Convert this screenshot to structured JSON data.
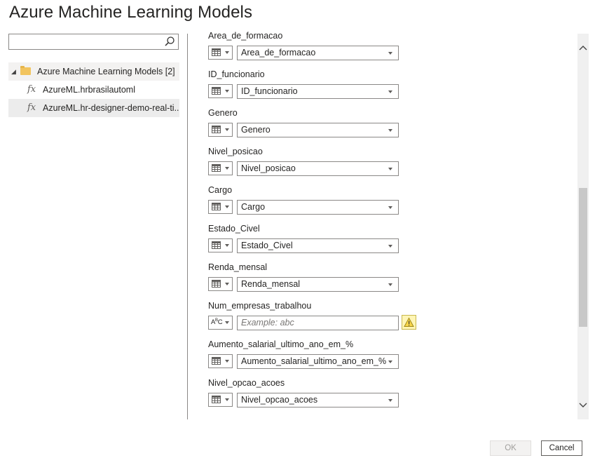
{
  "title": "Azure Machine Learning Models",
  "search": {
    "placeholder": "",
    "value": ""
  },
  "tree": {
    "folder": {
      "label": "Azure Machine Learning Models [2]"
    },
    "items": [
      {
        "label": "AzureML.hrbrasilautoml",
        "selected": false
      },
      {
        "label": "AzureML.hr-designer-demo-real-ti...",
        "selected": true
      }
    ]
  },
  "parameters": [
    {
      "label": "Area_de_formacao",
      "kind": "column",
      "value": "Area_de_formacao"
    },
    {
      "label": "ID_funcionario",
      "kind": "column",
      "value": "ID_funcionario"
    },
    {
      "label": "Genero",
      "kind": "column",
      "value": "Genero"
    },
    {
      "label": "Nivel_posicao",
      "kind": "column",
      "value": "Nivel_posicao"
    },
    {
      "label": "Cargo",
      "kind": "column",
      "value": "Cargo"
    },
    {
      "label": "Estado_Civel",
      "kind": "column",
      "value": "Estado_Civel"
    },
    {
      "label": "Renda_mensal",
      "kind": "column",
      "value": "Renda_mensal"
    },
    {
      "label": "Num_empresas_trabalhou",
      "kind": "text",
      "value": "",
      "placeholder": "Example: abc",
      "warning": true,
      "type_icon": "A B C"
    },
    {
      "label": "Aumento_salarial_ultimo_ano_em_%",
      "kind": "column",
      "value": "Aumento_salarial_ultimo_ano_em_%"
    },
    {
      "label": "Nivel_opcao_acoes",
      "kind": "column",
      "value": "Nivel_opcao_acoes"
    }
  ],
  "buttons": {
    "ok": "OK",
    "cancel": "Cancel"
  },
  "icons": {
    "search": "search-icon",
    "folder": "folder-icon",
    "function": "fx-icon",
    "table": "table-icon",
    "text_type": "abc-type-icon",
    "warning": "warning-icon"
  },
  "colors": {
    "warning_bg": "#fff5b5",
    "folder": "#f2c45e",
    "selected_row": "#ececec"
  }
}
